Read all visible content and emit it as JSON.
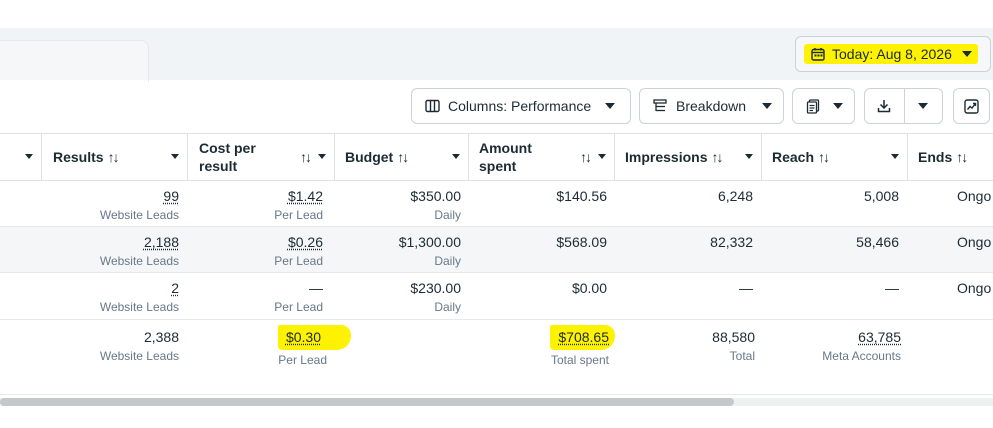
{
  "date_button": {
    "label": "Today: Aug 8, 2026"
  },
  "toolbar": {
    "columns_label": "Columns: Performance",
    "breakdown_label": "Breakdown"
  },
  "columns": [
    {
      "label": "Results",
      "sortable": true
    },
    {
      "label": "Cost per result",
      "line1": "Cost per",
      "line2": "result",
      "sortable": true
    },
    {
      "label": "Budget",
      "sortable": true
    },
    {
      "label": "Amount spent",
      "line1": "Amount",
      "line2": "spent",
      "sortable": true
    },
    {
      "label": "Impressions",
      "sortable": true
    },
    {
      "label": "Reach",
      "sortable": true
    },
    {
      "label": "Ends",
      "sortable": true
    }
  ],
  "rows": [
    {
      "results": "99",
      "results_sub": "Website Leads",
      "cpr": "$1.42",
      "cpr_sub": "Per Lead",
      "budget": "$350.00",
      "budget_sub": "Daily",
      "spent": "$140.56",
      "impressions": "6,248",
      "reach": "5,008",
      "ends": "Ongo"
    },
    {
      "results": "2,188",
      "results_sub": "Website Leads",
      "cpr": "$0.26",
      "cpr_sub": "Per Lead",
      "budget": "$1,300.00",
      "budget_sub": "Daily",
      "spent": "$568.09",
      "impressions": "82,332",
      "reach": "58,466",
      "ends": "Ongo"
    },
    {
      "results": "2",
      "results_sub": "Website Leads",
      "cpr": "—",
      "cpr_sub": "Per Lead",
      "budget": "$230.00",
      "budget_sub": "Daily",
      "spent": "$0.00",
      "impressions": "—",
      "reach": "—",
      "ends": "Ongo"
    }
  ],
  "totals": {
    "results": "2,388",
    "results_sub": "Website Leads",
    "cpr": "$0.30",
    "cpr_sub": "Per Lead",
    "spent": "$708.65",
    "spent_sub": "Total spent",
    "impressions": "88,580",
    "impressions_sub": "Total",
    "reach": "63,785",
    "reach_sub": "Meta Accounts"
  },
  "colors": {
    "highlight": "#fff200",
    "text": "#1c2b33",
    "muted": "#67788a"
  },
  "icons": [
    "calendar-icon",
    "columns-icon",
    "breakdown-icon",
    "reports-icon",
    "download-icon",
    "chart-icon"
  ]
}
